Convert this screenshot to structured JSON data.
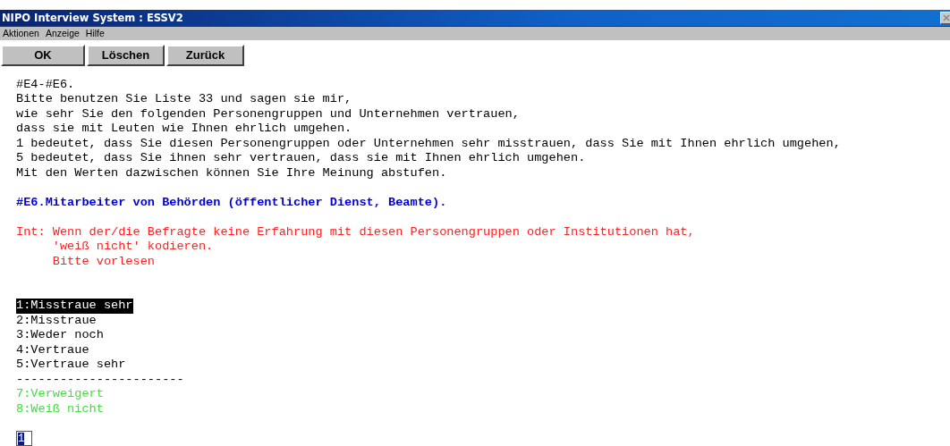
{
  "window": {
    "title": "NIPO Interview System : ESSV2"
  },
  "menu": [
    "Aktionen",
    "Anzeige",
    "Hilfe"
  ],
  "buttons": [
    "OK",
    "Löschen",
    "Zurück"
  ],
  "question": {
    "intro_lines": [
      "#E4-#E6.",
      "Bitte benutzen Sie Liste 33 und sagen sie mir,",
      "wie sehr Sie den folgenden Personengruppen und Unternehmen vertrauen,",
      "dass sie mit Leuten wie Ihnen ehrlich umgehen.",
      "1 bedeutet, dass Sie diesen Personengruppen oder Unternehmen sehr misstrauen, dass Sie mit Ihnen ehrlich umgehen,",
      "5 bedeutet, dass Sie ihnen sehr vertrauen, dass sie mit Ihnen ehrlich umgehen.",
      "Mit den Werten dazwischen können Sie Ihre Meinung abstufen."
    ],
    "title": "#E6.Mitarbeiter von Behörden (öffentlicher Dienst, Beamte).",
    "instruction_lines": [
      "Int: Wenn der/die Befragte keine Erfahrung mit diesen Personengruppen oder Institutionen hat,",
      "     'weiß nicht' kodieren.",
      "     Bitte vorlesen"
    ],
    "options": [
      {
        "label": "1:Misstraue sehr",
        "kind": "answer",
        "selected": true
      },
      {
        "label": "2:Misstraue",
        "kind": "answer",
        "selected": false
      },
      {
        "label": "3:Weder noch",
        "kind": "answer",
        "selected": false
      },
      {
        "label": "4:Vertraue",
        "kind": "answer",
        "selected": false
      },
      {
        "label": "5:Vertraue sehr",
        "kind": "answer",
        "selected": false
      },
      {
        "label": "-----------------------",
        "kind": "separator",
        "selected": false
      },
      {
        "label": "7:Verweigert",
        "kind": "special",
        "selected": false
      },
      {
        "label": "8:Weiß nicht",
        "kind": "special",
        "selected": false
      }
    ],
    "answer_value": "1"
  }
}
